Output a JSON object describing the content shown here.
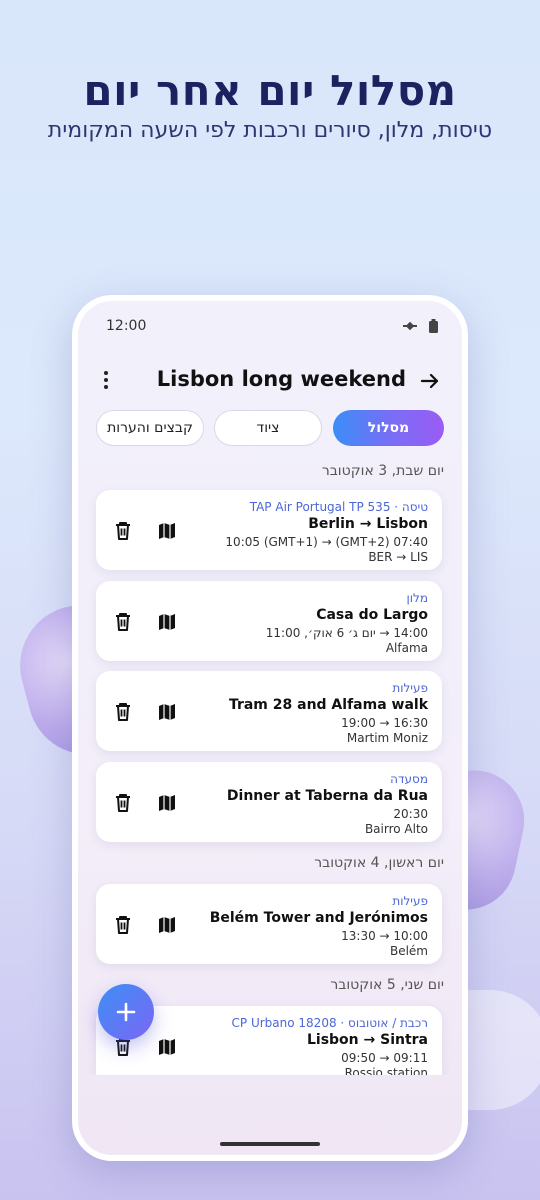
{
  "hero": {
    "title": "מסלול יום אחר יום",
    "subtitle": "טיסות, מלון, סיורים ורכבות לפי השעה המקומית"
  },
  "status_bar": {
    "time": "12:00",
    "icons": [
      "satellite-icon",
      "battery-icon"
    ]
  },
  "header": {
    "title": "Lisbon long weekend",
    "menu_icon": "more-vert-icon",
    "action_icon": "arrow-right-icon"
  },
  "tabs": [
    {
      "label": "מסלול",
      "active": true
    },
    {
      "label": "ציוד",
      "active": false
    },
    {
      "label": "קבצים והערות",
      "active": false
    }
  ],
  "days": [
    {
      "header": "יום שבת, 3 אוקטובר",
      "items": [
        {
          "type": "טיסה · TAP Air Portugal TP 535",
          "title": "Berlin → Lisbon",
          "time": "07:40 (GMT+2) → 10:05 (GMT+1)",
          "place": "BER → LIS"
        },
        {
          "type": "מלון",
          "title": "Casa do Largo",
          "time": "14:00 → יום ג׳ 6 אוק׳, 11:00",
          "place": "Alfama"
        },
        {
          "type": "פעילות",
          "title": "Tram 28 and Alfama walk",
          "time": "16:30 → 19:00",
          "place": "Martim Moniz"
        },
        {
          "type": "מסעדה",
          "title": "Dinner at Taberna da Rua",
          "time": "20:30",
          "place": "Bairro Alto"
        }
      ]
    },
    {
      "header": "יום ראשון, 4 אוקטובר",
      "items": [
        {
          "type": "פעילות",
          "title": "Belém Tower and Jerónimos",
          "time": "10:00 → 13:30",
          "place": "Belém"
        }
      ]
    },
    {
      "header": "יום שני, 5 אוקטובר",
      "items": [
        {
          "type": "רכבת / אוטובוס · CP Urbano 18208",
          "title": "Lisbon → Sintra",
          "time": "09:11 → 09:50",
          "place": "Rossio station"
        }
      ]
    }
  ],
  "fab": {
    "icon": "plus-icon"
  },
  "colors": {
    "accent": "#4b67d9",
    "gradient_start": "#3b8df7",
    "gradient_end": "#9a5cf4",
    "title": "#1c2260"
  }
}
